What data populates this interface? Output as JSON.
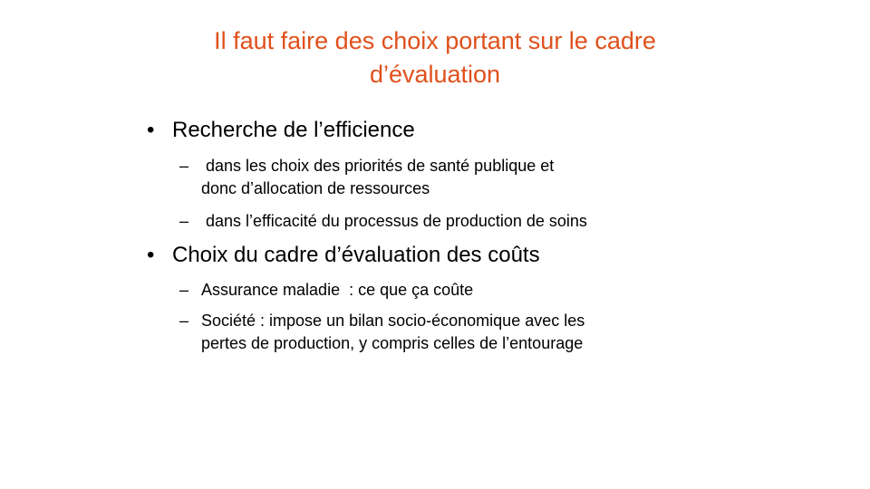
{
  "title": {
    "line1": "Il faut faire des choix portant sur le cadre",
    "line2": "d’évaluation"
  },
  "bullets": [
    {
      "label": "Recherche de l’efficience",
      "subs": [
        {
          "lines": [
            " dans les choix des priorités de santé publique et",
            "donc d’allocation de ressources"
          ]
        },
        {
          "lines": [
            " dans l’efficacité du processus de production de soins"
          ]
        }
      ]
    },
    {
      "label": "Choix du cadre d’évaluation des coûts",
      "subs": [
        {
          "lines": [
            "Assurance maladie  : ce que ça coûte"
          ]
        },
        {
          "lines": [
            "Société : impose un bilan socio-économique avec les",
            "pertes de production, y compris celles de l’entourage"
          ]
        }
      ]
    }
  ],
  "glyphs": {
    "bullet": "•",
    "dash": "–"
  },
  "colors": {
    "title": "#e0501c",
    "text": "#000000",
    "background": "#ffffff"
  }
}
